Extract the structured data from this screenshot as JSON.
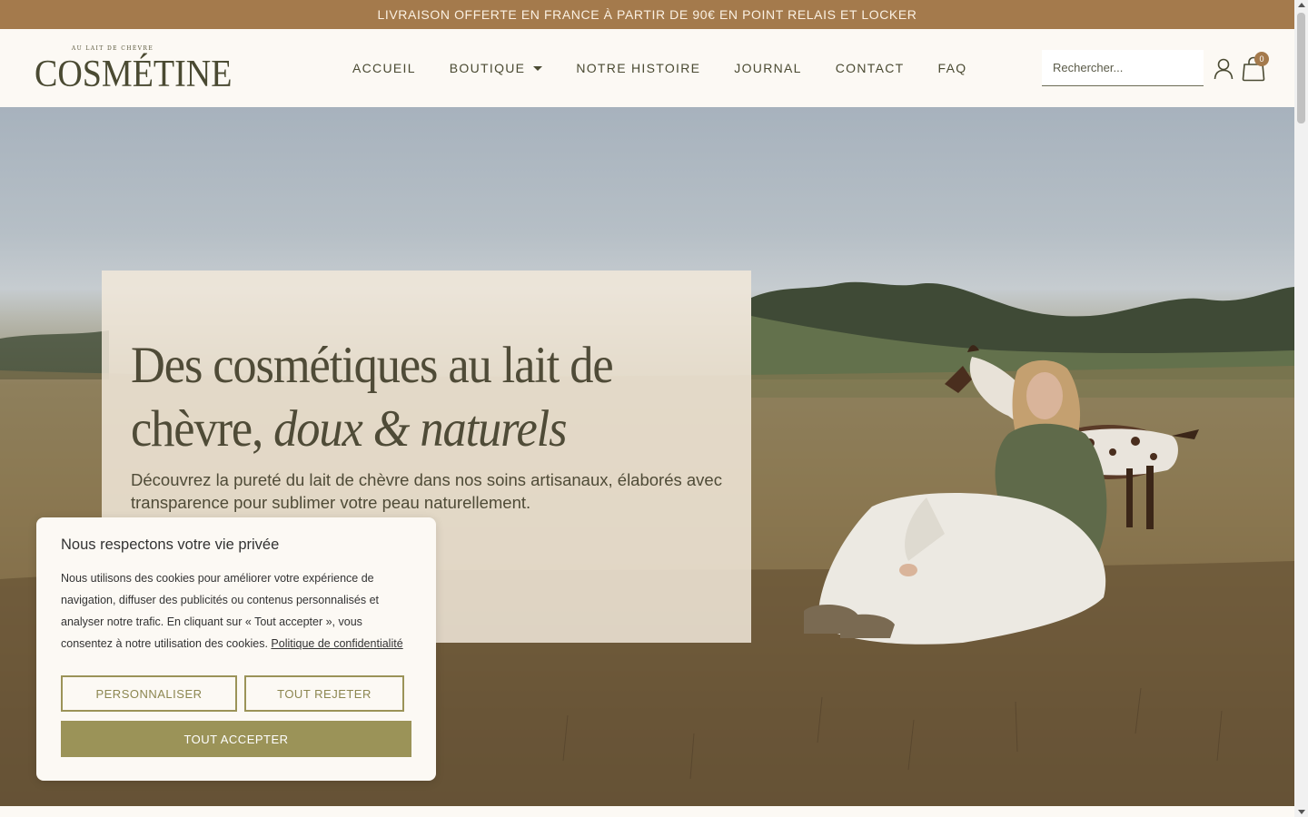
{
  "topbar": {
    "text": "LIVRAISON OFFERTE EN FRANCE À PARTIR DE 90€ EN POINT RELAIS ET LOCKER"
  },
  "logo": {
    "small": "AU LAIT DE CHÈVRE",
    "main": "COSMÉTINE"
  },
  "nav": {
    "items": [
      {
        "label": "ACCUEIL"
      },
      {
        "label": "BOUTIQUE"
      },
      {
        "label": "NOTRE HISTOIRE"
      },
      {
        "label": "JOURNAL"
      },
      {
        "label": "CONTACT"
      },
      {
        "label": "FAQ"
      }
    ]
  },
  "search": {
    "placeholder": "Rechercher..."
  },
  "cart": {
    "count": "0"
  },
  "icons": {
    "user": "user-icon",
    "cart": "shopping-bag-icon",
    "caret": "caret-down-icon"
  },
  "hero": {
    "title_line1": "Des cosmétiques au lait de",
    "title_line2_plain": "chèvre, ",
    "title_line2_italic": "doux & naturels",
    "subtitle": "Découvrez la pureté du lait de chèvre dans nos soins artisanaux, élaborés avec transparence pour sublimer votre peau naturellement."
  },
  "cookie": {
    "title": "Nous respectons votre vie privée",
    "text": "Nous utilisons des cookies pour améliorer votre expérience de navigation, diffuser des publicités ou contenus personnalisés et analyser notre trafic. En cliquant sur « Tout accepter », vous consentez à notre utilisation des cookies.",
    "policy_link": "Politique de confidentialité",
    "btn_customize": "PERSONNALISER",
    "btn_reject": "TOUT REJETER",
    "btn_accept": "TOUT ACCEPTER"
  },
  "colors": {
    "topbar_bg": "#a47a4c",
    "brand_text": "#4a4a32",
    "accent_olive": "#9b9358",
    "card_bg": "#f1e8da"
  }
}
